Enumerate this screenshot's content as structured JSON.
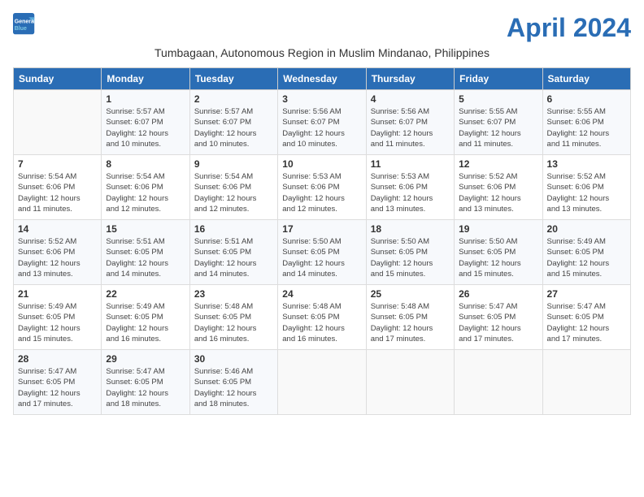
{
  "header": {
    "logo_line1": "General",
    "logo_line2": "Blue",
    "month_title": "April 2024",
    "subtitle": "Tumbagaan, Autonomous Region in Muslim Mindanao, Philippines"
  },
  "weekdays": [
    "Sunday",
    "Monday",
    "Tuesday",
    "Wednesday",
    "Thursday",
    "Friday",
    "Saturday"
  ],
  "weeks": [
    [
      {
        "day": "",
        "info": ""
      },
      {
        "day": "1",
        "info": "Sunrise: 5:57 AM\nSunset: 6:07 PM\nDaylight: 12 hours\nand 10 minutes."
      },
      {
        "day": "2",
        "info": "Sunrise: 5:57 AM\nSunset: 6:07 PM\nDaylight: 12 hours\nand 10 minutes."
      },
      {
        "day": "3",
        "info": "Sunrise: 5:56 AM\nSunset: 6:07 PM\nDaylight: 12 hours\nand 10 minutes."
      },
      {
        "day": "4",
        "info": "Sunrise: 5:56 AM\nSunset: 6:07 PM\nDaylight: 12 hours\nand 11 minutes."
      },
      {
        "day": "5",
        "info": "Sunrise: 5:55 AM\nSunset: 6:07 PM\nDaylight: 12 hours\nand 11 minutes."
      },
      {
        "day": "6",
        "info": "Sunrise: 5:55 AM\nSunset: 6:06 PM\nDaylight: 12 hours\nand 11 minutes."
      }
    ],
    [
      {
        "day": "7",
        "info": "Sunrise: 5:54 AM\nSunset: 6:06 PM\nDaylight: 12 hours\nand 11 minutes."
      },
      {
        "day": "8",
        "info": "Sunrise: 5:54 AM\nSunset: 6:06 PM\nDaylight: 12 hours\nand 12 minutes."
      },
      {
        "day": "9",
        "info": "Sunrise: 5:54 AM\nSunset: 6:06 PM\nDaylight: 12 hours\nand 12 minutes."
      },
      {
        "day": "10",
        "info": "Sunrise: 5:53 AM\nSunset: 6:06 PM\nDaylight: 12 hours\nand 12 minutes."
      },
      {
        "day": "11",
        "info": "Sunrise: 5:53 AM\nSunset: 6:06 PM\nDaylight: 12 hours\nand 13 minutes."
      },
      {
        "day": "12",
        "info": "Sunrise: 5:52 AM\nSunset: 6:06 PM\nDaylight: 12 hours\nand 13 minutes."
      },
      {
        "day": "13",
        "info": "Sunrise: 5:52 AM\nSunset: 6:06 PM\nDaylight: 12 hours\nand 13 minutes."
      }
    ],
    [
      {
        "day": "14",
        "info": "Sunrise: 5:52 AM\nSunset: 6:06 PM\nDaylight: 12 hours\nand 13 minutes."
      },
      {
        "day": "15",
        "info": "Sunrise: 5:51 AM\nSunset: 6:05 PM\nDaylight: 12 hours\nand 14 minutes."
      },
      {
        "day": "16",
        "info": "Sunrise: 5:51 AM\nSunset: 6:05 PM\nDaylight: 12 hours\nand 14 minutes."
      },
      {
        "day": "17",
        "info": "Sunrise: 5:50 AM\nSunset: 6:05 PM\nDaylight: 12 hours\nand 14 minutes."
      },
      {
        "day": "18",
        "info": "Sunrise: 5:50 AM\nSunset: 6:05 PM\nDaylight: 12 hours\nand 15 minutes."
      },
      {
        "day": "19",
        "info": "Sunrise: 5:50 AM\nSunset: 6:05 PM\nDaylight: 12 hours\nand 15 minutes."
      },
      {
        "day": "20",
        "info": "Sunrise: 5:49 AM\nSunset: 6:05 PM\nDaylight: 12 hours\nand 15 minutes."
      }
    ],
    [
      {
        "day": "21",
        "info": "Sunrise: 5:49 AM\nSunset: 6:05 PM\nDaylight: 12 hours\nand 15 minutes."
      },
      {
        "day": "22",
        "info": "Sunrise: 5:49 AM\nSunset: 6:05 PM\nDaylight: 12 hours\nand 16 minutes."
      },
      {
        "day": "23",
        "info": "Sunrise: 5:48 AM\nSunset: 6:05 PM\nDaylight: 12 hours\nand 16 minutes."
      },
      {
        "day": "24",
        "info": "Sunrise: 5:48 AM\nSunset: 6:05 PM\nDaylight: 12 hours\nand 16 minutes."
      },
      {
        "day": "25",
        "info": "Sunrise: 5:48 AM\nSunset: 6:05 PM\nDaylight: 12 hours\nand 17 minutes."
      },
      {
        "day": "26",
        "info": "Sunrise: 5:47 AM\nSunset: 6:05 PM\nDaylight: 12 hours\nand 17 minutes."
      },
      {
        "day": "27",
        "info": "Sunrise: 5:47 AM\nSunset: 6:05 PM\nDaylight: 12 hours\nand 17 minutes."
      }
    ],
    [
      {
        "day": "28",
        "info": "Sunrise: 5:47 AM\nSunset: 6:05 PM\nDaylight: 12 hours\nand 17 minutes."
      },
      {
        "day": "29",
        "info": "Sunrise: 5:47 AM\nSunset: 6:05 PM\nDaylight: 12 hours\nand 18 minutes."
      },
      {
        "day": "30",
        "info": "Sunrise: 5:46 AM\nSunset: 6:05 PM\nDaylight: 12 hours\nand 18 minutes."
      },
      {
        "day": "",
        "info": ""
      },
      {
        "day": "",
        "info": ""
      },
      {
        "day": "",
        "info": ""
      },
      {
        "day": "",
        "info": ""
      }
    ]
  ]
}
